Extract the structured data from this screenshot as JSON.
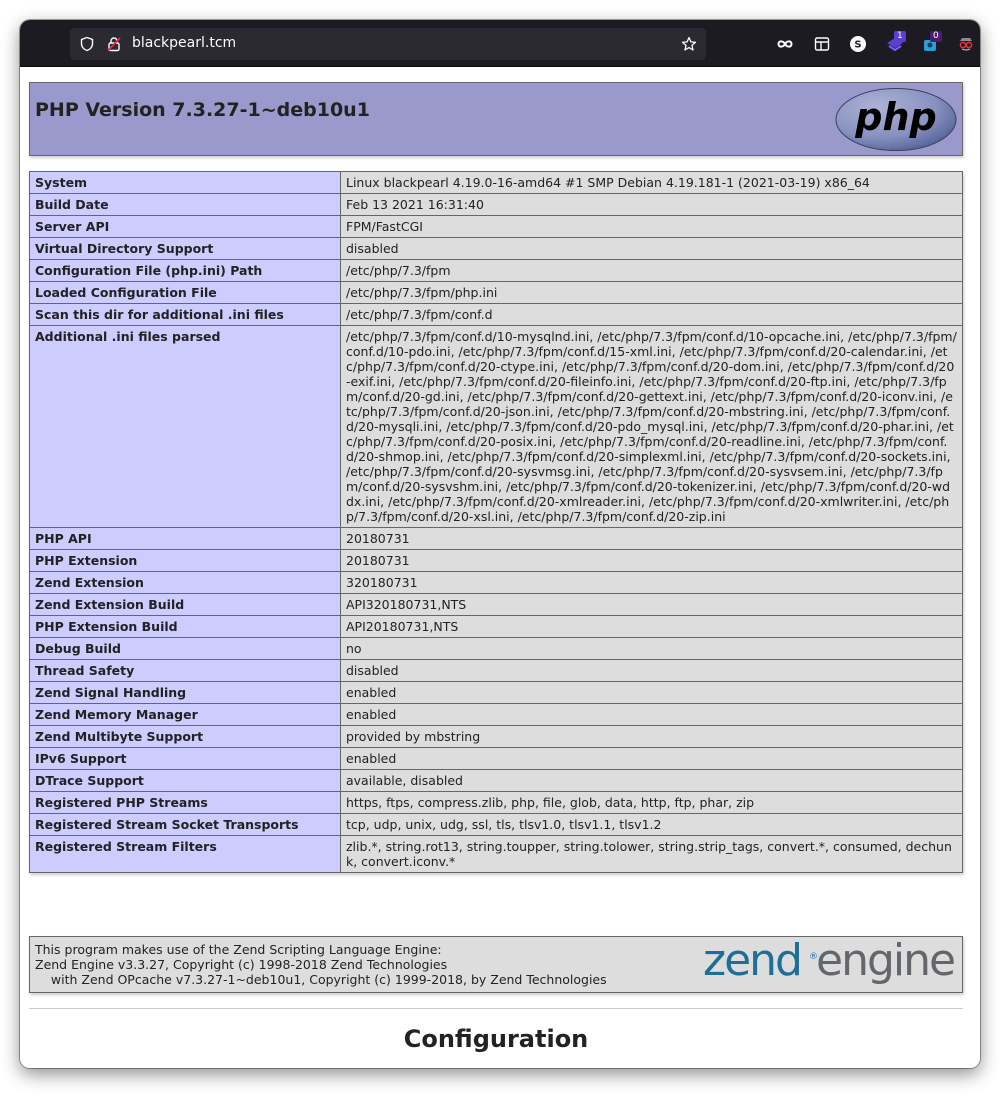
{
  "browser": {
    "url": "blackpearl.tcm",
    "extension_badges": [
      "1",
      "0"
    ],
    "icons": [
      "shield-icon",
      "lock-insecure-icon",
      "star-bookmark-icon",
      "infinity-icon",
      "reader-view-icon",
      "s-extension-icon",
      "extension-1-icon",
      "extension-2-icon",
      "spy-extension-icon"
    ]
  },
  "header": {
    "title": "PHP Version 7.3.27-1~deb10u1",
    "logo_text": "php"
  },
  "info_rows": [
    {
      "key": "System",
      "value": "Linux blackpearl 4.19.0-16-amd64 #1 SMP Debian 4.19.181-1 (2021-03-19) x86_64"
    },
    {
      "key": "Build Date",
      "value": "Feb 13 2021 16:31:40"
    },
    {
      "key": "Server API",
      "value": "FPM/FastCGI"
    },
    {
      "key": "Virtual Directory Support",
      "value": "disabled"
    },
    {
      "key": "Configuration File (php.ini) Path",
      "value": "/etc/php/7.3/fpm"
    },
    {
      "key": "Loaded Configuration File",
      "value": "/etc/php/7.3/fpm/php.ini"
    },
    {
      "key": "Scan this dir for additional .ini files",
      "value": "/etc/php/7.3/fpm/conf.d"
    },
    {
      "key": "Additional .ini files parsed",
      "value": "/etc/php/7.3/fpm/conf.d/10-mysqlnd.ini, /etc/php/7.3/fpm/conf.d/10-opcache.ini, /etc/php/7.3/fpm/conf.d/10-pdo.ini, /etc/php/7.3/fpm/conf.d/15-xml.ini, /etc/php/7.3/fpm/conf.d/20-calendar.ini, /etc/php/7.3/fpm/conf.d/20-ctype.ini, /etc/php/7.3/fpm/conf.d/20-dom.ini, /etc/php/7.3/fpm/conf.d/20-exif.ini, /etc/php/7.3/fpm/conf.d/20-fileinfo.ini, /etc/php/7.3/fpm/conf.d/20-ftp.ini, /etc/php/7.3/fpm/conf.d/20-gd.ini, /etc/php/7.3/fpm/conf.d/20-gettext.ini, /etc/php/7.3/fpm/conf.d/20-iconv.ini, /etc/php/7.3/fpm/conf.d/20-json.ini, /etc/php/7.3/fpm/conf.d/20-mbstring.ini, /etc/php/7.3/fpm/conf.d/20-mysqli.ini, /etc/php/7.3/fpm/conf.d/20-pdo_mysql.ini, /etc/php/7.3/fpm/conf.d/20-phar.ini, /etc/php/7.3/fpm/conf.d/20-posix.ini, /etc/php/7.3/fpm/conf.d/20-readline.ini, /etc/php/7.3/fpm/conf.d/20-shmop.ini, /etc/php/7.3/fpm/conf.d/20-simplexml.ini, /etc/php/7.3/fpm/conf.d/20-sockets.ini, /etc/php/7.3/fpm/conf.d/20-sysvmsg.ini, /etc/php/7.3/fpm/conf.d/20-sysvsem.ini, /etc/php/7.3/fpm/conf.d/20-sysvshm.ini, /etc/php/7.3/fpm/conf.d/20-tokenizer.ini, /etc/php/7.3/fpm/conf.d/20-wddx.ini, /etc/php/7.3/fpm/conf.d/20-xmlreader.ini, /etc/php/7.3/fpm/conf.d/20-xmlwriter.ini, /etc/php/7.3/fpm/conf.d/20-xsl.ini, /etc/php/7.3/fpm/conf.d/20-zip.ini"
    },
    {
      "key": "PHP API",
      "value": "20180731"
    },
    {
      "key": "PHP Extension",
      "value": "20180731"
    },
    {
      "key": "Zend Extension",
      "value": "320180731"
    },
    {
      "key": "Zend Extension Build",
      "value": "API320180731,NTS"
    },
    {
      "key": "PHP Extension Build",
      "value": "API20180731,NTS"
    },
    {
      "key": "Debug Build",
      "value": "no"
    },
    {
      "key": "Thread Safety",
      "value": "disabled"
    },
    {
      "key": "Zend Signal Handling",
      "value": "enabled"
    },
    {
      "key": "Zend Memory Manager",
      "value": "enabled"
    },
    {
      "key": "Zend Multibyte Support",
      "value": "provided by mbstring"
    },
    {
      "key": "IPv6 Support",
      "value": "enabled"
    },
    {
      "key": "DTrace Support",
      "value": "available, disabled"
    },
    {
      "key": "Registered PHP Streams",
      "value": "https, ftps, compress.zlib, php, file, glob, data, http, ftp, phar, zip"
    },
    {
      "key": "Registered Stream Socket Transports",
      "value": "tcp, udp, unix, udg, ssl, tls, tlsv1.0, tlsv1.1, tlsv1.2"
    },
    {
      "key": "Registered Stream Filters",
      "value": "zlib.*, string.rot13, string.toupper, string.tolower, string.strip_tags, convert.*, consumed, dechunk, convert.iconv.*"
    }
  ],
  "zend": {
    "text": "This program makes use of the Zend Scripting Language Engine:\nZend Engine v3.3.27, Copyright (c) 1998-2018 Zend Technologies\n    with Zend OPcache v7.3.27-1~deb10u1, Copyright (c) 1999-2018, by Zend Technologies",
    "logo_text": "zend®engine"
  },
  "section_title": "Configuration",
  "colors": {
    "header_bg": "#9999cc",
    "key_bg": "#ccccff",
    "value_bg": "#dddddd",
    "browser_bar": "#1c1b22"
  }
}
